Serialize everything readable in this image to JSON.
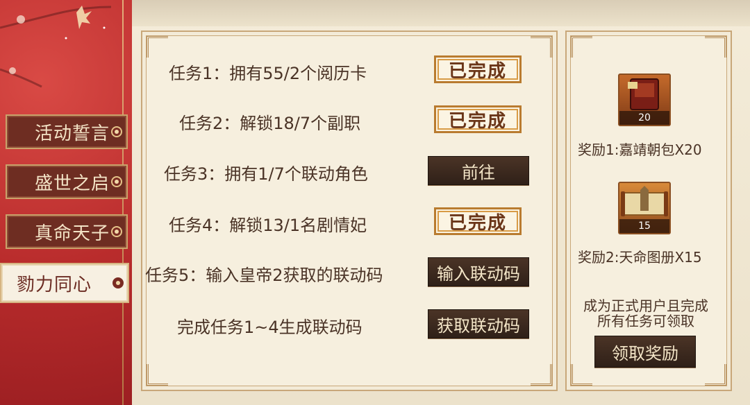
{
  "sidebar": {
    "tabs": [
      {
        "label": "活动誓言"
      },
      {
        "label": "盛世之启"
      },
      {
        "label": "真命天子"
      },
      {
        "label": "勠力同心",
        "active": true
      }
    ]
  },
  "tasks": [
    {
      "text": "任务1：拥有55/2个阅历卡",
      "status": "completed",
      "action_label": "已完成"
    },
    {
      "text": "任务2：解锁18/7个副职",
      "status": "completed",
      "action_label": "已完成"
    },
    {
      "text": "任务3：拥有1/7个联动角色",
      "status": "go",
      "action_label": "前往"
    },
    {
      "text": "任务4：解锁13/1名剧情妃",
      "status": "completed",
      "action_label": "已完成"
    },
    {
      "text": "任务5：输入皇帝2获取的联动码",
      "status": "input",
      "action_label": "输入联动码"
    },
    {
      "text": "完成任务1~4生成联动码",
      "status": "generate",
      "action_label": "获取联动码"
    }
  ],
  "rewards": [
    {
      "label": "奖励1:嘉靖朝包X20",
      "count": "20",
      "icon": "book-chest-icon"
    },
    {
      "label": "奖励2:天命图册X15",
      "count": "15",
      "icon": "scroll-map-icon"
    }
  ],
  "claim": {
    "note_line1": "成为正式用户且完成",
    "note_line2": "所有任务可领取",
    "button_label": "领取奖励"
  },
  "colors": {
    "accent_red": "#b92c2c",
    "dark_button": "#3a281e",
    "stamp_border": "#b97b2f",
    "parchment": "#f6efde"
  }
}
